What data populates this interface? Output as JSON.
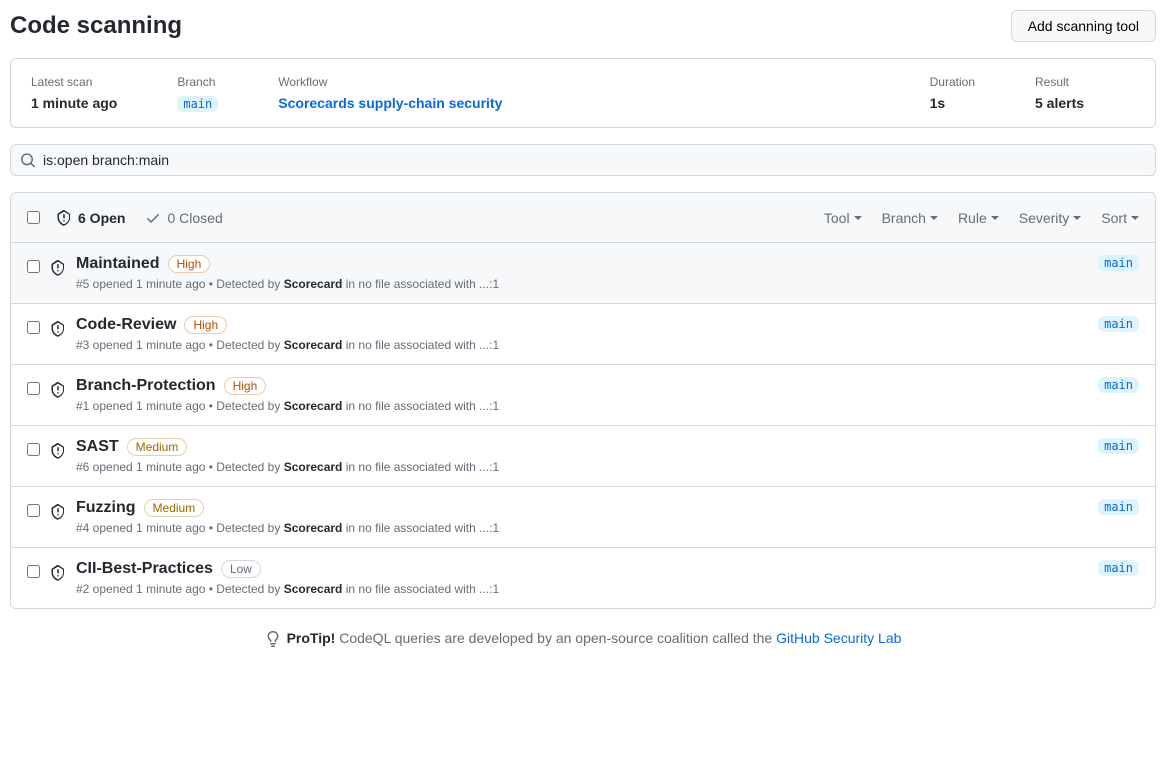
{
  "header": {
    "title": "Code scanning",
    "add_button": "Add scanning tool"
  },
  "summary": {
    "latest_scan_label": "Latest scan",
    "latest_scan_value": "1 minute ago",
    "branch_label": "Branch",
    "branch_value": "main",
    "workflow_label": "Workflow",
    "workflow_value": "Scorecards supply-chain security",
    "duration_label": "Duration",
    "duration_value": "1s",
    "result_label": "Result",
    "result_value": "5 alerts"
  },
  "search": {
    "value": "is:open branch:main"
  },
  "tabs": {
    "open": "6 Open",
    "closed": "0 Closed"
  },
  "filters": {
    "tool": "Tool",
    "branch": "Branch",
    "rule": "Rule",
    "severity": "Severity",
    "sort": "Sort"
  },
  "alerts": [
    {
      "title": "Maintained",
      "severity": "High",
      "severity_class": "high",
      "meta_prefix": "#5 opened 1 minute ago • Detected by ",
      "tool": "Scorecard",
      "meta_suffix": " in no file associated with ...:1",
      "branch": "main",
      "hover": true
    },
    {
      "title": "Code-Review",
      "severity": "High",
      "severity_class": "high",
      "meta_prefix": "#3 opened 1 minute ago • Detected by ",
      "tool": "Scorecard",
      "meta_suffix": " in no file associated with ...:1",
      "branch": "main",
      "hover": false
    },
    {
      "title": "Branch-Protection",
      "severity": "High",
      "severity_class": "high",
      "meta_prefix": "#1 opened 1 minute ago • Detected by ",
      "tool": "Scorecard",
      "meta_suffix": " in no file associated with ...:1",
      "branch": "main",
      "hover": false
    },
    {
      "title": "SAST",
      "severity": "Medium",
      "severity_class": "medium",
      "meta_prefix": "#6 opened 1 minute ago • Detected by ",
      "tool": "Scorecard",
      "meta_suffix": " in no file associated with ...:1",
      "branch": "main",
      "hover": false
    },
    {
      "title": "Fuzzing",
      "severity": "Medium",
      "severity_class": "medium",
      "meta_prefix": "#4 opened 1 minute ago • Detected by ",
      "tool": "Scorecard",
      "meta_suffix": " in no file associated with ...:1",
      "branch": "main",
      "hover": false
    },
    {
      "title": "CII-Best-Practices",
      "severity": "Low",
      "severity_class": "low",
      "meta_prefix": "#2 opened 1 minute ago • Detected by ",
      "tool": "Scorecard",
      "meta_suffix": " in no file associated with ...:1",
      "branch": "main",
      "hover": false
    }
  ],
  "protip": {
    "label": "ProTip!",
    "text": " CodeQL queries are developed by an open-source coalition called the ",
    "link": "GitHub Security Lab"
  }
}
